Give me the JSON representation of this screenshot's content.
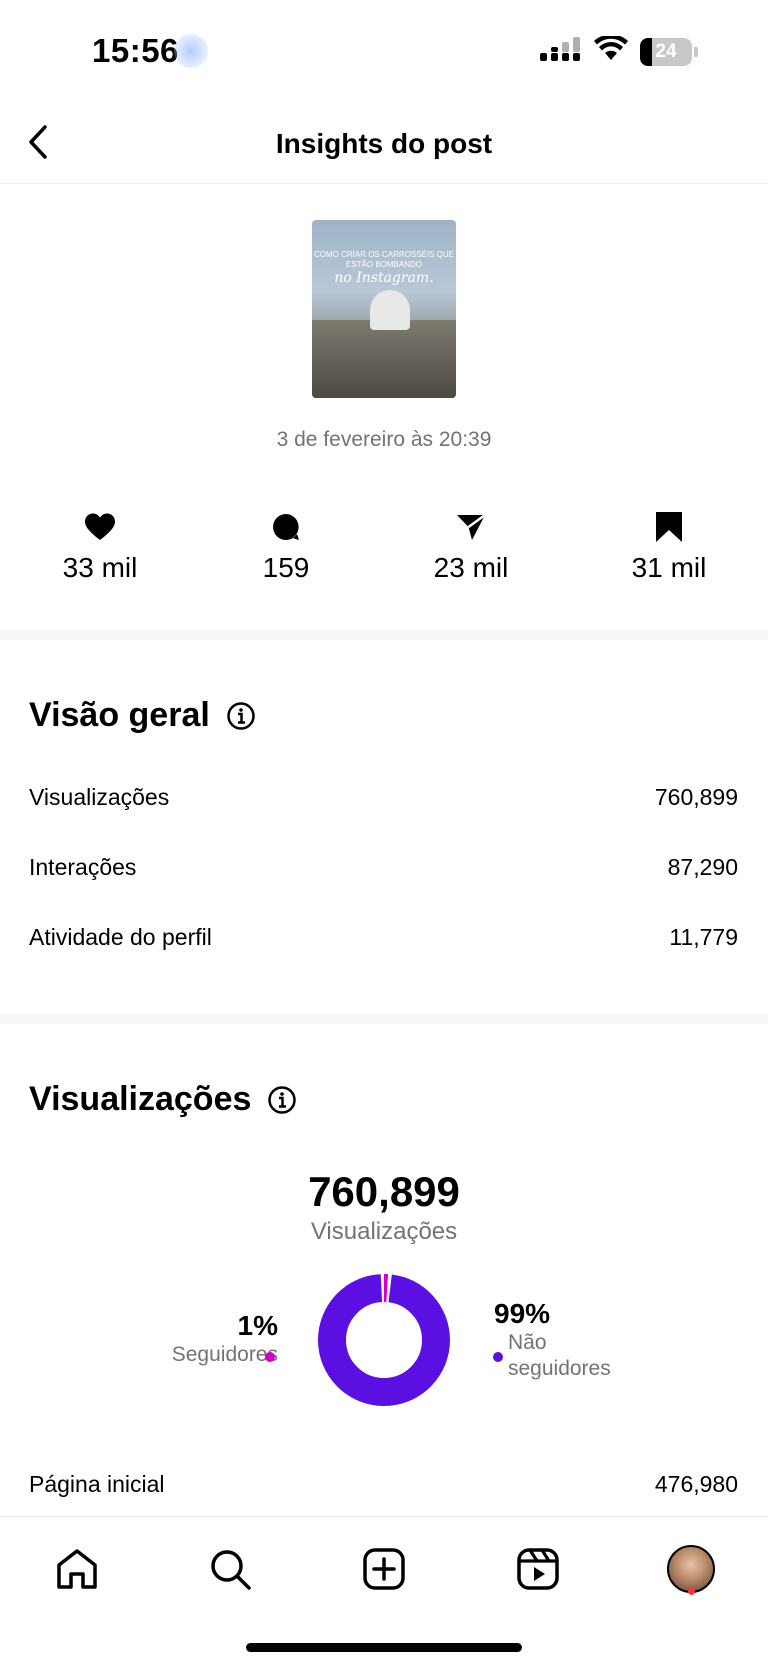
{
  "status_bar": {
    "time": "15:56",
    "battery": "24",
    "battery_fraction": 0.24
  },
  "header": {
    "title": "Insights do post",
    "back_icon": "chevron-left-icon"
  },
  "post": {
    "thumbnail_caption": "COMO CRIAR OS CARROSSÉIS QUE ESTÃO BOMBANDO",
    "thumbnail_headline": "no Instagram.",
    "date": "3 de fevereiro às 20:39"
  },
  "stats": {
    "likes": "33 mil",
    "comments": "159",
    "shares": "23 mil",
    "saves": "31 mil"
  },
  "overview": {
    "title": "Visão geral",
    "rows": [
      {
        "label": "Visualizações",
        "value": "760,899"
      },
      {
        "label": "Interações",
        "value": "87,290"
      },
      {
        "label": "Atividade do perfil",
        "value": "11,779"
      }
    ]
  },
  "views": {
    "title": "Visualizações",
    "total": "760,899",
    "total_label": "Visualizações",
    "followers_pct": "1%",
    "followers_label": "Seguidores",
    "non_followers_pct": "99%",
    "non_followers_label_1": "Não",
    "non_followers_label_2": "seguidores",
    "followers_fraction": 0.01,
    "colors": {
      "followers": "#d300c5",
      "non_followers": "#5b0fe0"
    },
    "home_label": "Página inicial",
    "home_value": "476,980"
  },
  "tab_bar": {
    "icons": [
      "home-icon",
      "search-icon",
      "create-icon",
      "reels-icon",
      "profile-avatar"
    ]
  }
}
